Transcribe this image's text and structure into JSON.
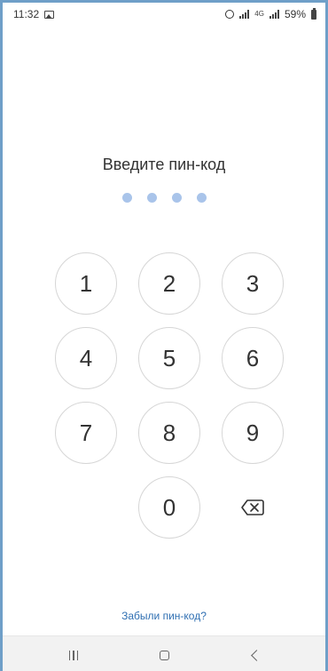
{
  "status_bar": {
    "time": "11:32",
    "net_type": "4G",
    "battery": "59%"
  },
  "title": "Введите пин-код",
  "pin": {
    "digits_entered": 4,
    "dot_color": "#a9c4ea"
  },
  "keypad": {
    "keys": [
      "1",
      "2",
      "3",
      "4",
      "5",
      "6",
      "7",
      "8",
      "9",
      "0"
    ],
    "backspace_icon": "backspace-icon"
  },
  "forgot_link": "Забыли пин-код?",
  "nav_bar": {
    "recents_icon": "recents-icon",
    "home_icon": "home-icon",
    "back_icon": "back-icon"
  },
  "colors": {
    "link": "#2f6fb2",
    "frame_border": "#6f9fc8"
  }
}
